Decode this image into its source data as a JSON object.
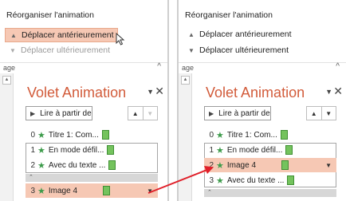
{
  "ribbon": {
    "title": "Réorganiser l'animation",
    "move_earlier": "Déplacer antérieurement",
    "move_later": "Déplacer ultérieurement",
    "group_label": "age",
    "icons": {
      "up": "triangle-up-icon",
      "down": "triangle-down-icon",
      "collapse": "chevron-up-icon"
    }
  },
  "panel": {
    "title": "Volet Animation",
    "menu_icon": "triangle-down-icon",
    "close_icon": "close-icon",
    "play_label": "Lire à partir de",
    "play_icon": "play-icon"
  },
  "left_list": [
    {
      "num": "0",
      "label": "Titre 1: Com..."
    },
    {
      "num": "1",
      "label": "En mode défil..."
    },
    {
      "num": "2",
      "label": "Avec du texte ..."
    },
    {
      "num": "3",
      "label": "Image 4"
    }
  ],
  "right_list": [
    {
      "num": "0",
      "label": "Titre 1: Com..."
    },
    {
      "num": "1",
      "label": "En mode défil..."
    },
    {
      "num": "2",
      "label": "Image 4"
    },
    {
      "num": "3",
      "label": "Avec du texte ..."
    }
  ],
  "colors": {
    "highlight": "#f6c8b4",
    "title": "#d25b3a",
    "star": "#3d9b4b",
    "arrow": "#e0202a"
  }
}
